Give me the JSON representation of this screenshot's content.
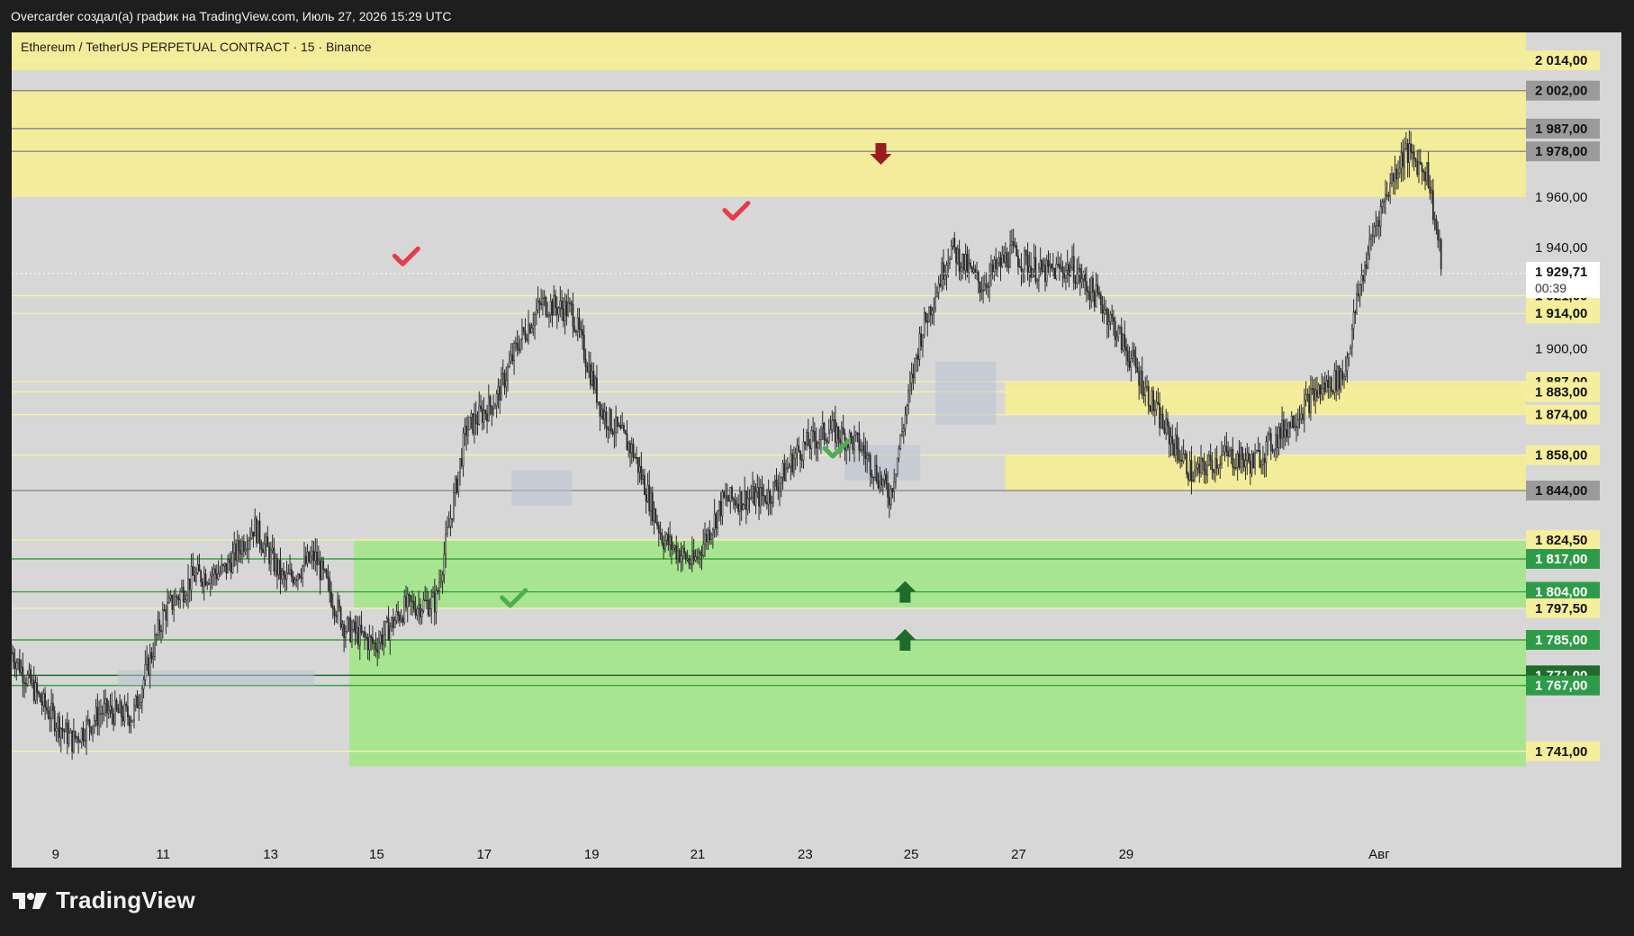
{
  "header": {
    "attribution": "Overcarder создал(а) график на TradingView.com, Июль 27, 2026 15:29 UTC"
  },
  "legend": {
    "text": "Ethereum / TetherUS PERPETUAL CONTRACT · 15 · Binance"
  },
  "footer": {
    "brand": "TradingView"
  },
  "chart_data": {
    "type": "candlestick",
    "symbol": "Ethereum / TetherUS PERPETUAL CONTRACT",
    "interval": "15",
    "exchange": "Binance",
    "grid": false,
    "colors": {
      "background": "#d7d7d7",
      "resistance_zone": "#f3ec9a",
      "support_zone": "#a8e591",
      "support_line": "#3aa63a",
      "support_label_bg": "#2e9b48",
      "resistance_label_bg": "#f5ee9c",
      "candle": "#2a2a2a",
      "check_red": "#e63b4a",
      "check_green": "#4caf50",
      "arrow_down": "#9b1b1f",
      "arrow_up": "#1e6b2a"
    },
    "x_axis": {
      "ticks": [
        "9",
        "11",
        "13",
        "15",
        "17",
        "19",
        "21",
        "23",
        "25",
        "27",
        "29",
        "Авг"
      ]
    },
    "y_axis": {
      "visible_ticks": [
        "1 960,00",
        "1 940,00",
        "1 900,00"
      ]
    },
    "current_price": {
      "value": "1 929,71",
      "countdown": "00:39"
    },
    "price_labels": [
      {
        "text": "2 014,00",
        "style": "yellow"
      },
      {
        "text": "2 002,00",
        "style": "gray"
      },
      {
        "text": "1 987,00",
        "style": "gray"
      },
      {
        "text": "1 978,00",
        "style": "gray"
      },
      {
        "text": "1 921,00",
        "style": "yellow"
      },
      {
        "text": "1 914,00",
        "style": "yellow"
      },
      {
        "text": "1 887,00",
        "style": "yellow"
      },
      {
        "text": "1 883,00",
        "style": "yellow"
      },
      {
        "text": "1 874,00",
        "style": "yellow"
      },
      {
        "text": "1 858,00",
        "style": "yellow"
      },
      {
        "text": "1 844,00",
        "style": "gray"
      },
      {
        "text": "1 824,50",
        "style": "yellow"
      },
      {
        "text": "1 817,00",
        "style": "green"
      },
      {
        "text": "1 804,00",
        "style": "green"
      },
      {
        "text": "1 797,50",
        "style": "yellow"
      },
      {
        "text": "1 785,00",
        "style": "green"
      },
      {
        "text": "1 771,00",
        "style": "darkgreen"
      },
      {
        "text": "1 767,00",
        "style": "green"
      },
      {
        "text": "1 741,00",
        "style": "yellow"
      }
    ],
    "zones": [
      {
        "type": "resistance",
        "from": 1960,
        "to": 2002
      },
      {
        "type": "resistance",
        "from": 1874,
        "to": 1887
      },
      {
        "type": "resistance",
        "from": 1844,
        "to": 1858
      },
      {
        "type": "support",
        "from": 1797.5,
        "to": 1824.5
      },
      {
        "type": "support",
        "from": 1735,
        "to": 1785
      }
    ],
    "price_path": [
      [
        0.0,
        1780
      ],
      [
        0.02,
        1760
      ],
      [
        0.04,
        1745
      ],
      [
        0.06,
        1757
      ],
      [
        0.08,
        1755
      ],
      [
        0.1,
        1795
      ],
      [
        0.12,
        1810
      ],
      [
        0.14,
        1812
      ],
      [
        0.16,
        1830
      ],
      [
        0.18,
        1808
      ],
      [
        0.2,
        1818
      ],
      [
        0.22,
        1790
      ],
      [
        0.24,
        1783
      ],
      [
        0.26,
        1798
      ],
      [
        0.28,
        1800
      ],
      [
        0.3,
        1868
      ],
      [
        0.32,
        1880
      ],
      [
        0.335,
        1903
      ],
      [
        0.35,
        1918
      ],
      [
        0.37,
        1915
      ],
      [
        0.39,
        1875
      ],
      [
        0.41,
        1860
      ],
      [
        0.43,
        1825
      ],
      [
        0.45,
        1815
      ],
      [
        0.47,
        1840
      ],
      [
        0.5,
        1842
      ],
      [
        0.52,
        1860
      ],
      [
        0.54,
        1868
      ],
      [
        0.56,
        1862
      ],
      [
        0.58,
        1842
      ],
      [
        0.6,
        1905
      ],
      [
        0.62,
        1940
      ],
      [
        0.64,
        1925
      ],
      [
        0.66,
        1938
      ],
      [
        0.68,
        1930
      ],
      [
        0.7,
        1932
      ],
      [
        0.72,
        1918
      ],
      [
        0.74,
        1895
      ],
      [
        0.76,
        1870
      ],
      [
        0.78,
        1850
      ],
      [
        0.8,
        1858
      ],
      [
        0.82,
        1855
      ],
      [
        0.84,
        1868
      ],
      [
        0.86,
        1882
      ],
      [
        0.88,
        1890
      ],
      [
        0.89,
        1924
      ],
      [
        0.9,
        1948
      ],
      [
        0.91,
        1965
      ],
      [
        0.92,
        1978
      ],
      [
        0.935,
        1970
      ],
      [
        0.945,
        1930
      ]
    ],
    "annotations": [
      {
        "type": "check",
        "color": "red",
        "x": 0.26,
        "price": 1936
      },
      {
        "type": "check",
        "color": "red",
        "x": 0.478,
        "price": 1954
      },
      {
        "type": "check",
        "color": "green",
        "x": 0.331,
        "price": 1801
      },
      {
        "type": "check",
        "color": "green",
        "x": 0.544,
        "price": 1860
      },
      {
        "type": "arrow",
        "direction": "down",
        "x": 0.574,
        "price": 1977
      },
      {
        "type": "arrow",
        "direction": "up",
        "x": 0.59,
        "price": 1804
      },
      {
        "type": "arrow",
        "direction": "up",
        "x": 0.59,
        "price": 1785
      }
    ]
  }
}
